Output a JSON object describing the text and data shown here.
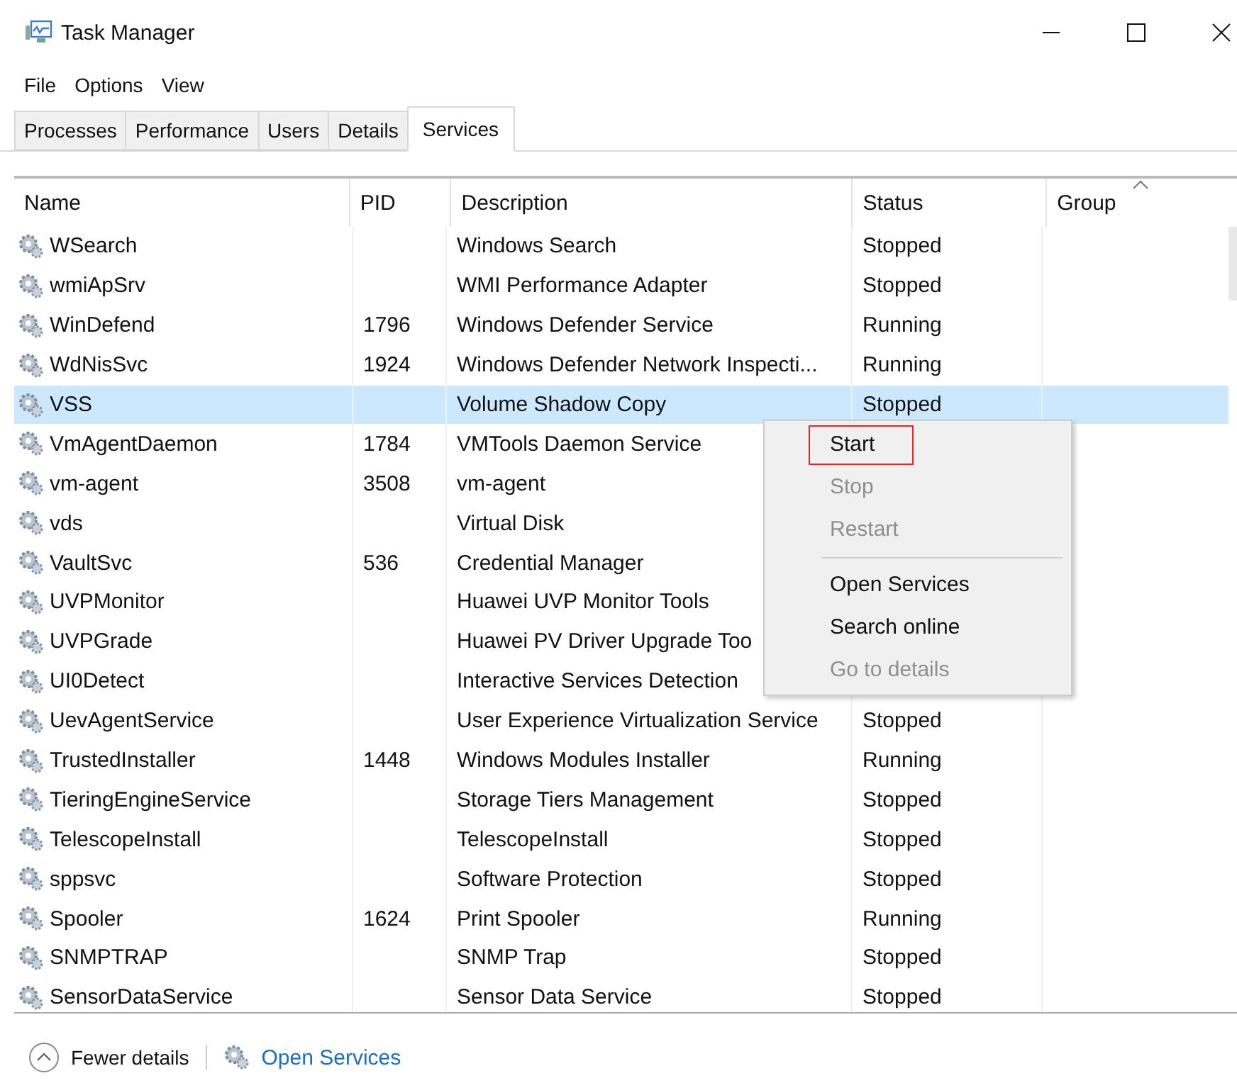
{
  "window": {
    "title": "Task Manager"
  },
  "menu_bar": [
    "File",
    "Options",
    "View"
  ],
  "tabs": [
    {
      "label": "Processes",
      "selected": false
    },
    {
      "label": "Performance",
      "selected": false
    },
    {
      "label": "Users",
      "selected": false
    },
    {
      "label": "Details",
      "selected": false
    },
    {
      "label": "Services",
      "selected": true
    }
  ],
  "table": {
    "columns": [
      "Name",
      "PID",
      "Description",
      "Status",
      "Group"
    ],
    "rows": [
      {
        "name": "WSearch",
        "pid": "",
        "description": "Windows Search",
        "status": "Stopped",
        "selected": false
      },
      {
        "name": "wmiApSrv",
        "pid": "",
        "description": "WMI Performance Adapter",
        "status": "Stopped",
        "selected": false
      },
      {
        "name": "WinDefend",
        "pid": "1796",
        "description": "Windows Defender Service",
        "status": "Running",
        "selected": false
      },
      {
        "name": "WdNisSvc",
        "pid": "1924",
        "description": "Windows Defender Network Inspecti...",
        "status": "Running",
        "selected": false
      },
      {
        "name": "VSS",
        "pid": "",
        "description": "Volume Shadow Copy",
        "status": "Stopped",
        "selected": true
      },
      {
        "name": "VmAgentDaemon",
        "pid": "1784",
        "description": "VMTools Daemon Service",
        "status": "",
        "selected": false
      },
      {
        "name": "vm-agent",
        "pid": "3508",
        "description": "vm-agent",
        "status": "",
        "selected": false
      },
      {
        "name": "vds",
        "pid": "",
        "description": "Virtual Disk",
        "status": "",
        "selected": false
      },
      {
        "name": "VaultSvc",
        "pid": "536",
        "description": "Credential Manager",
        "status": "",
        "selected": false
      },
      {
        "name": "UVPMonitor",
        "pid": "",
        "description": "Huawei UVP Monitor Tools",
        "status": "",
        "selected": false
      },
      {
        "name": "UVPGrade",
        "pid": "",
        "description": "Huawei PV Driver Upgrade Too",
        "status": "",
        "selected": false
      },
      {
        "name": "UI0Detect",
        "pid": "",
        "description": "Interactive Services Detection",
        "status": "",
        "selected": false
      },
      {
        "name": "UevAgentService",
        "pid": "",
        "description": "User Experience Virtualization Service",
        "status": "Stopped",
        "selected": false
      },
      {
        "name": "TrustedInstaller",
        "pid": "1448",
        "description": "Windows Modules Installer",
        "status": "Running",
        "selected": false
      },
      {
        "name": "TieringEngineService",
        "pid": "",
        "description": "Storage Tiers Management",
        "status": "Stopped",
        "selected": false
      },
      {
        "name": "TelescopeInstall",
        "pid": "",
        "description": "TelescopeInstall",
        "status": "Stopped",
        "selected": false
      },
      {
        "name": "sppsvc",
        "pid": "",
        "description": "Software Protection",
        "status": "Stopped",
        "selected": false
      },
      {
        "name": "Spooler",
        "pid": "1624",
        "description": "Print Spooler",
        "status": "Running",
        "selected": false
      },
      {
        "name": "SNMPTRAP",
        "pid": "",
        "description": "SNMP Trap",
        "status": "Stopped",
        "selected": false
      },
      {
        "name": "SensorDataService",
        "pid": "",
        "description": "Sensor Data Service",
        "status": "Stopped",
        "selected": false
      }
    ]
  },
  "context_menu": [
    {
      "kind": "item",
      "label": "Start",
      "disabled": false,
      "highlighted": true
    },
    {
      "kind": "item",
      "label": "Stop",
      "disabled": true,
      "highlighted": false
    },
    {
      "kind": "item",
      "label": "Restart",
      "disabled": true,
      "highlighted": false
    },
    {
      "kind": "separator"
    },
    {
      "kind": "item",
      "label": "Open Services",
      "disabled": false,
      "highlighted": false
    },
    {
      "kind": "item",
      "label": "Search online",
      "disabled": false,
      "highlighted": false
    },
    {
      "kind": "item",
      "label": "Go to details",
      "disabled": true,
      "highlighted": false
    }
  ],
  "footer": {
    "fewer_details": "Fewer details",
    "open_services": "Open Services"
  }
}
